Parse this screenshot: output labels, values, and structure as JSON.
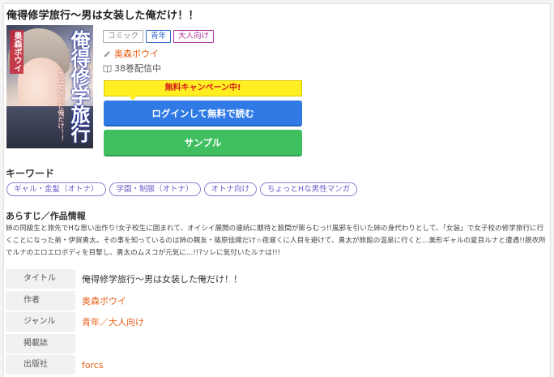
{
  "title": "俺得修学旅行～男は女装した俺だけ！！",
  "cover": {
    "title_text": "俺得修学旅行",
    "author_text": "奥森ボウイ",
    "subtitle_text": "男は女装した俺だけ！！"
  },
  "tags": [
    "コミック",
    "青年",
    "大人向け"
  ],
  "author": "奥森ボウイ",
  "volumes": "38巻配信中",
  "campaign_label": "無料キャンペーン中!",
  "login_button": "ログインして無料で読む",
  "sample_button": "サンプル",
  "keywords": {
    "heading": "キーワード",
    "items": [
      "ギャル・金髪（オトナ）",
      "学園・制服（オトナ）",
      "オトナ向け",
      "ちょっとHな男性マンガ"
    ]
  },
  "synopsis": {
    "heading": "あらすじ／作品情報",
    "body": "姉の同級生と旅先でHな思い出作り!女子校生に囲まれて、オイシイ展開の連続に期待と股間が膨らむっ!!風邪を引いた姉の身代わりとして、「女装」で女子校の修学旅行に行くことになった弟・伊賀勇太。その事を知っているのは姉の親友・篠原佳織だけ☆夜遅くに人目を避けて、勇太が旅館の温泉に行くと…美形ギャルの夏目ルナと遭遇!!脱衣所でルナのエロエロボディを目撃し、勇太のムスコが元気に…!!?ソレに気付いたルナは!!!"
  },
  "meta": [
    {
      "label": "タイトル",
      "value": "俺得修学旅行～男は女装した俺だけ！！",
      "link": false
    },
    {
      "label": "作者",
      "value": "奥森ボウイ",
      "link": true
    },
    {
      "label": "ジャンル",
      "value": "青年／大人向け",
      "link": true
    },
    {
      "label": "掲載誌",
      "value": "",
      "link": false
    },
    {
      "label": "出版社",
      "value": "forcs",
      "link": true
    }
  ],
  "colors": {
    "accent_orange": "#e85e17",
    "login_blue": "#2f7ae5",
    "sample_green": "#3fbf5f",
    "campaign_yellow": "#ffee22",
    "keyword_purple": "#6f5bc8"
  }
}
